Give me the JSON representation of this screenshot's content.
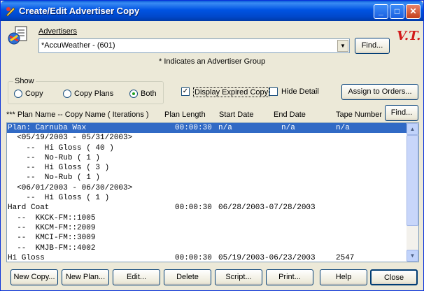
{
  "window": {
    "title": "Create/Edit Advertiser Copy"
  },
  "advertisers": {
    "label": "Advertisers",
    "value": "*AccuWeather - (601)",
    "find_label": "Find...",
    "note": "* Indicates an Advertiser Group"
  },
  "logo_text": "V.T.",
  "show": {
    "caption": "Show",
    "options": [
      "Copy",
      "Copy Plans",
      "Both"
    ],
    "selected": "Both"
  },
  "display_expired": {
    "label": "Display Expired Copy",
    "checked": true
  },
  "hide_detail": {
    "label": "Hide Detail",
    "checked": false
  },
  "assign_button": "Assign to Orders...",
  "columns": {
    "plan_name": "*** Plan Name  --  Copy Name ( Iterations )",
    "plan_length": "Plan Length",
    "start_date": "Start Date",
    "end_date": "End Date",
    "tape_number": "Tape Number",
    "find_label": "Find..."
  },
  "rows": [
    {
      "name": "Plan: Carnuba Wax",
      "length": "00:00:30",
      "start": "n/a",
      "end": "n/a",
      "tape": "n/a",
      "selected": true
    },
    {
      "name": "  <05/19/2003 - 05/31/2003>",
      "length": "",
      "start": "",
      "end": "",
      "tape": ""
    },
    {
      "name": "    --  Hi Gloss ( 40 )",
      "length": "",
      "start": "",
      "end": "",
      "tape": ""
    },
    {
      "name": "    --  No-Rub ( 1 )",
      "length": "",
      "start": "",
      "end": "",
      "tape": ""
    },
    {
      "name": "    --  Hi Gloss ( 3 )",
      "length": "",
      "start": "",
      "end": "",
      "tape": ""
    },
    {
      "name": "    --  No-Rub ( 1 )",
      "length": "",
      "start": "",
      "end": "",
      "tape": ""
    },
    {
      "name": "  <06/01/2003 - 06/30/2003>",
      "length": "",
      "start": "",
      "end": "",
      "tape": ""
    },
    {
      "name": "    --  Hi Gloss ( 1 )",
      "length": "",
      "start": "",
      "end": "",
      "tape": ""
    },
    {
      "name": "Hard Coat",
      "length": "00:00:30",
      "start": "06/28/2003-07/28/2003",
      "end": "",
      "tape": ""
    },
    {
      "name": "  --  KKCK-FM::1005",
      "length": "",
      "start": "",
      "end": "",
      "tape": ""
    },
    {
      "name": "  --  KKCM-FM::2009",
      "length": "",
      "start": "",
      "end": "",
      "tape": ""
    },
    {
      "name": "  --  KMCI-FM::3009",
      "length": "",
      "start": "",
      "end": "",
      "tape": ""
    },
    {
      "name": "  --  KMJB-FM::4002",
      "length": "",
      "start": "",
      "end": "",
      "tape": ""
    },
    {
      "name": "Hi Gloss",
      "length": "00:00:30",
      "start": "05/19/2003-06/23/2003",
      "end": "",
      "tape": "2547"
    }
  ],
  "buttons": [
    "New Copy...",
    "New Plan...",
    "Edit...",
    "Delete",
    "Script...",
    "Print...",
    "Help",
    "Close"
  ]
}
